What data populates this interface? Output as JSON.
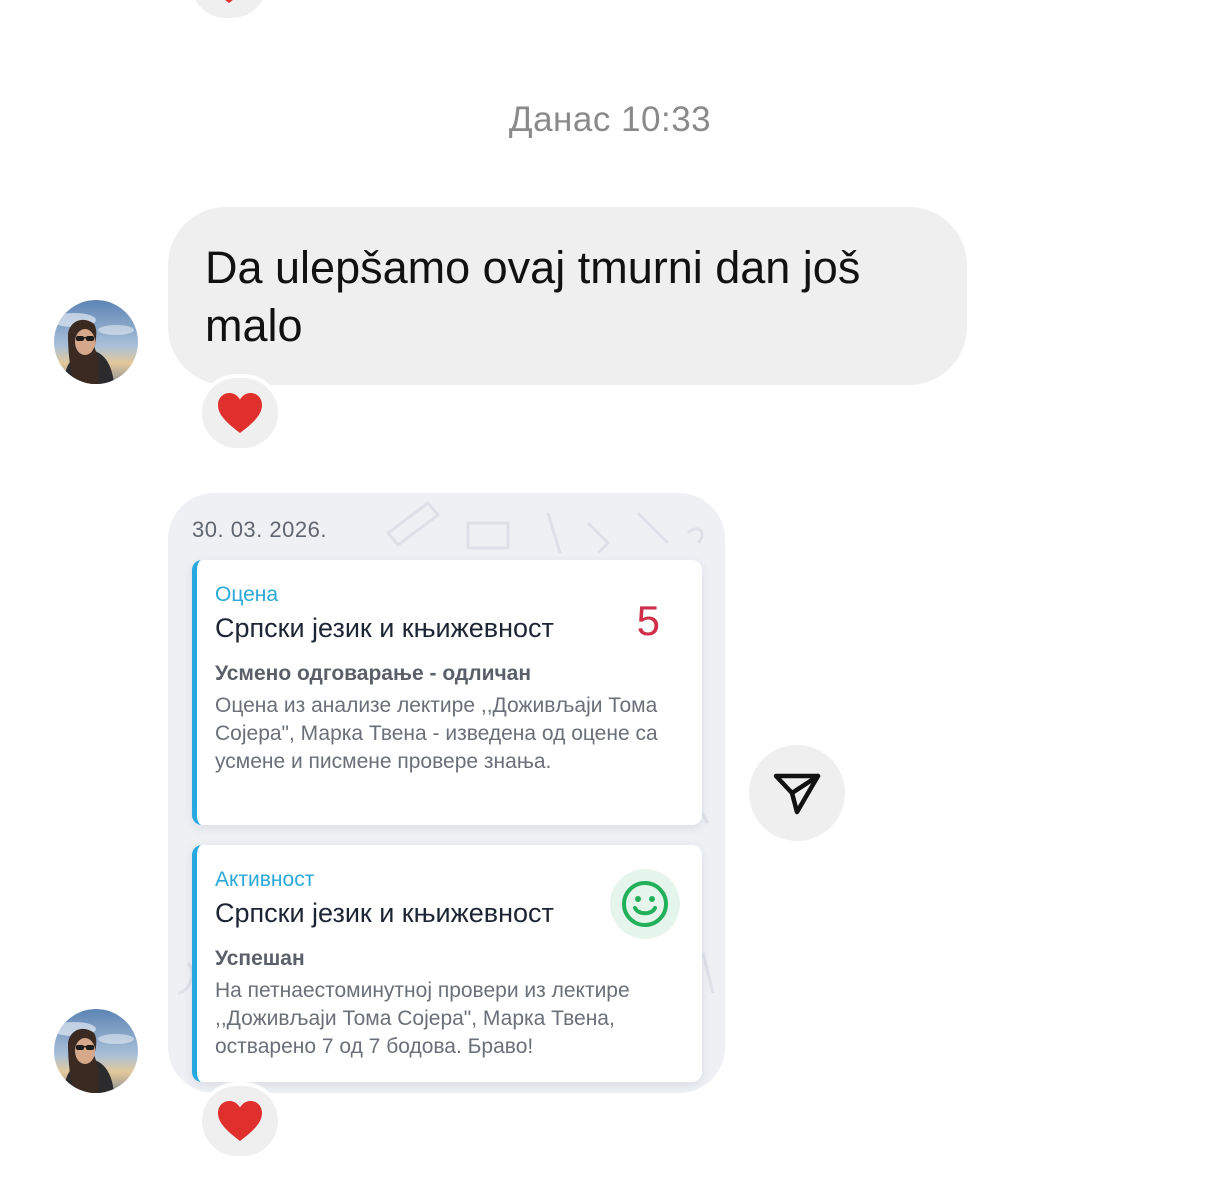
{
  "timestamp": "Данас 10:33",
  "messages": [
    {
      "type": "text",
      "text": "Da ulepšamo ovaj tmurni dan još malo",
      "reaction": "heart"
    },
    {
      "type": "image",
      "reaction": "heart",
      "image": {
        "date": "30. 03. 2026.",
        "cards": [
          {
            "type_label": "Оцена",
            "subject": "Српски језик и књижевност",
            "grade": "5",
            "title": "Усмено одговарање - одличан",
            "description": "Оцена из анализе лектире ,,Доживљаји Тома Сојера\", Марка Твена - изведена од оцене са усмене и писмене провере знања."
          },
          {
            "type_label": "Активност",
            "subject": "Српски језик и књижевност",
            "icon": "smiley-icon",
            "title": "Успешан",
            "description": "На петнаестоминутној провери из лектире ,,Доживљаји Тома Сојера\", Марка Твена, остварено 7 од 7 бодова. Браво!"
          }
        ]
      }
    }
  ],
  "icons": {
    "reaction": "heart-icon",
    "share": "send-icon",
    "avatar": "avatar"
  },
  "colors": {
    "bubble_bg": "#efefef",
    "grade": "#d0304a",
    "accent": "#27a8e0",
    "smiley": "#22b05a",
    "heart": "#e0302e"
  }
}
